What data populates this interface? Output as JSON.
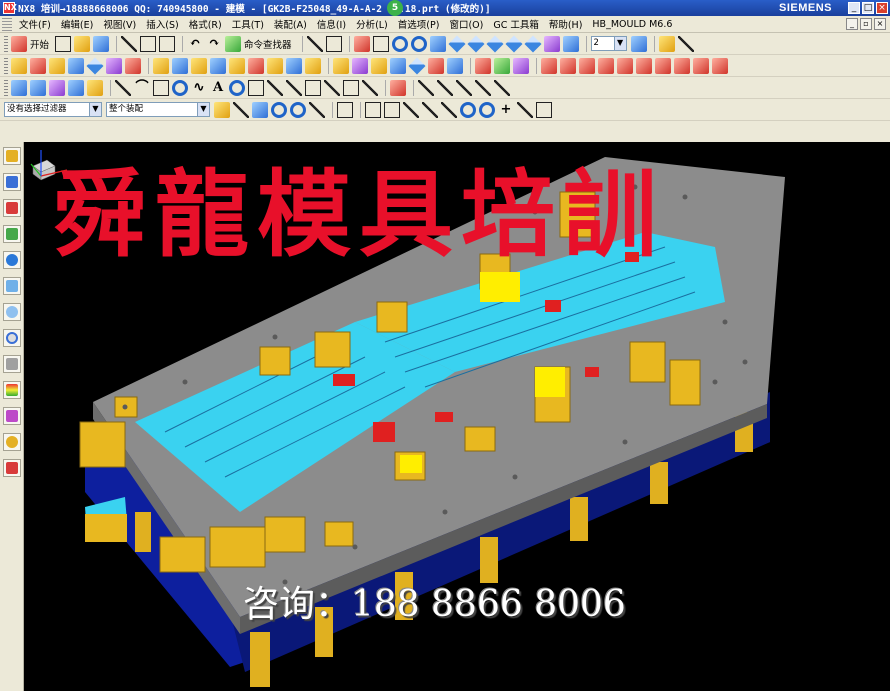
{
  "window": {
    "app_badge": "NX",
    "title": "NX8 培训→18888668006 QQ: 740945800 - 建模 - [GK2B-F25048_49-A-A-2 01.18.prt (修改的)]",
    "brand": "SIEMENS",
    "min_label": "_",
    "max_label": "□",
    "close_label": "×",
    "status_badge": "5"
  },
  "menu": {
    "items": [
      "文件(F)",
      "编辑(E)",
      "视图(V)",
      "插入(S)",
      "格式(R)",
      "工具(T)",
      "装配(A)",
      "信息(I)",
      "分析(L)",
      "首选项(P)",
      "窗口(O)",
      "GC 工具箱",
      "帮助(H)",
      "HB_MOULD M6.6"
    ]
  },
  "toolbar": {
    "start_label": "开始",
    "command_finder_label": "命令查找器",
    "layer_value": "2",
    "selection_filter": "没有选择过滤器",
    "assembly_scope": "整个装配"
  },
  "overlay": {
    "banner_text": "舜龍模具培訓",
    "contact_text": "咨询：188 8866 8006"
  },
  "colors": {
    "banner": "#e8102a",
    "plate_gray": "#8c8c8c",
    "insert_cyan": "#3ad2f0",
    "block_yellow": "#e8b820",
    "base_blue": "#0d1f9e"
  }
}
